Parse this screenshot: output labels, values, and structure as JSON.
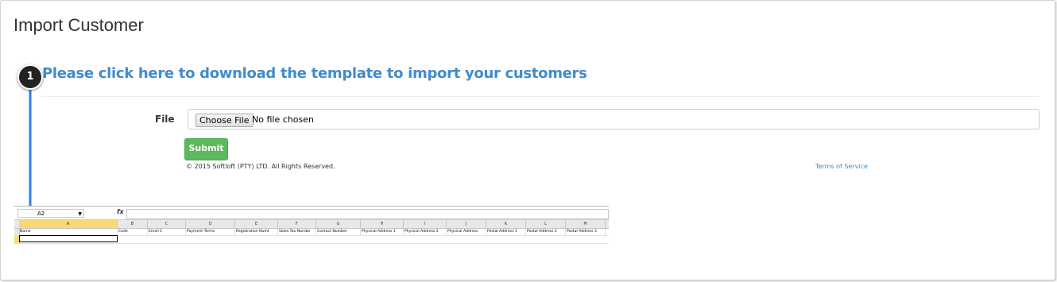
{
  "page": {
    "title": "Import Customer",
    "download_link": "Please click here to download the template to import your customers"
  },
  "form": {
    "file_label": "File",
    "choose_button": "Choose File",
    "no_file_text": "No file chosen",
    "submit_label": "Submit"
  },
  "footer": {
    "copyright": "© 2015 Softloft (PTY) LTD. All Rights Reserved.",
    "terms": "Terms of Service"
  },
  "annotation": {
    "step_number": "1"
  },
  "spreadsheet": {
    "name_box": "A2",
    "fx_label": "fx",
    "column_letters": [
      "A",
      "B",
      "C",
      "D",
      "E",
      "F",
      "G",
      "H",
      "I",
      "J",
      "K",
      "L",
      "M"
    ],
    "headers": [
      "Name",
      "Code",
      "Email 1",
      "Payment Terms",
      "Registration Numt",
      "Sales Tax Numbe",
      "Contact Number",
      "Physical Address 1",
      "Physical Address 2",
      "Physical Address",
      "Postal Address 1",
      "Postal Address 2",
      "Postal Address 3"
    ]
  },
  "colors": {
    "link": "#428bca",
    "submit_bg": "#5cb85c",
    "arrow": "#2f80e4",
    "selected_column": "#f8d973"
  }
}
